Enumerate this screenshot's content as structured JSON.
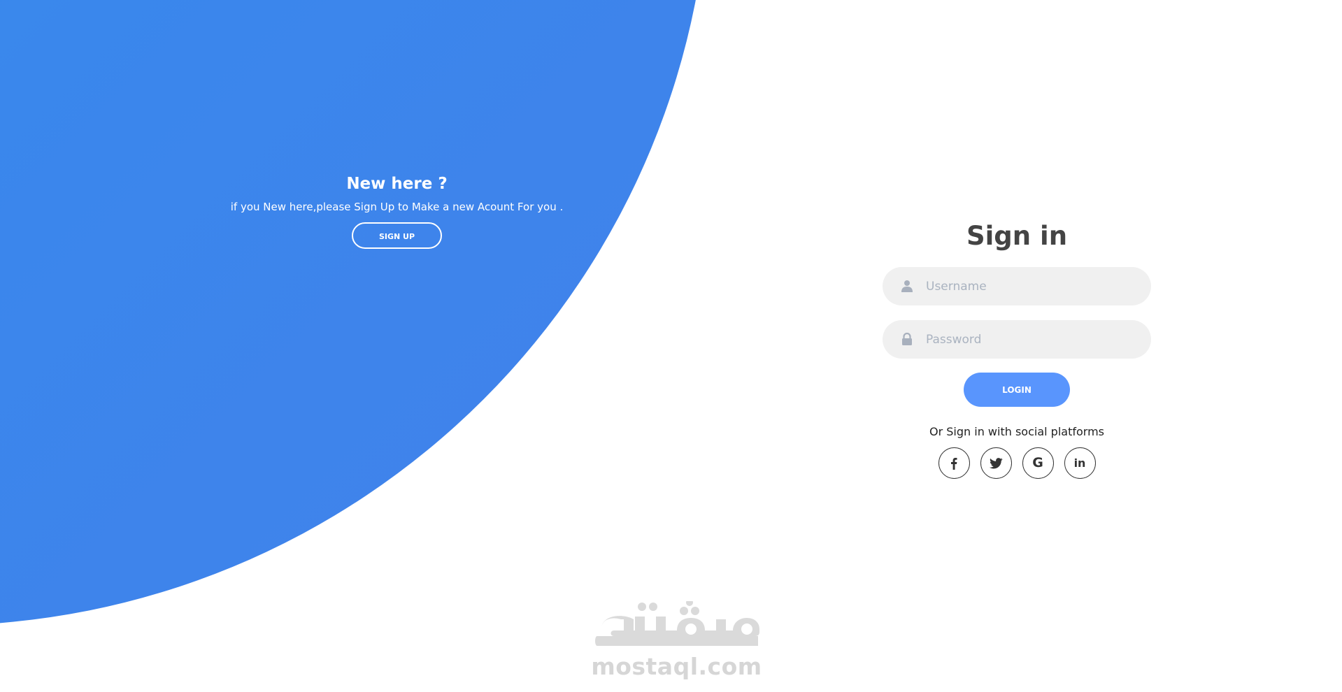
{
  "left_panel": {
    "title": "New here ?",
    "text": "if you New here,please Sign Up to Make a new Acount For you .",
    "button_label": "SIGN UP"
  },
  "signin": {
    "title": "Sign in",
    "username": {
      "placeholder": "Username",
      "value": "",
      "icon": "user-icon"
    },
    "password": {
      "placeholder": "Password",
      "value": "",
      "icon": "lock-icon"
    },
    "login_label": "LOGIN",
    "social_text": "Or Sign in with social platforms",
    "social": [
      {
        "name": "facebook",
        "glyph": "f",
        "icon": "facebook-icon"
      },
      {
        "name": "twitter",
        "icon": "twitter-icon"
      },
      {
        "name": "google",
        "glyph": "G",
        "icon": "google-icon"
      },
      {
        "name": "linkedin",
        "glyph": "in",
        "icon": "linkedin-icon"
      }
    ]
  },
  "watermark": {
    "text": "mostaql.com",
    "logo_text": "مستقل"
  },
  "colors": {
    "blob_start": "#2f9bf0",
    "blob_end": "#4281ea",
    "primary": "#5995fd",
    "field_bg": "#f0f0f0",
    "title": "#444444"
  }
}
